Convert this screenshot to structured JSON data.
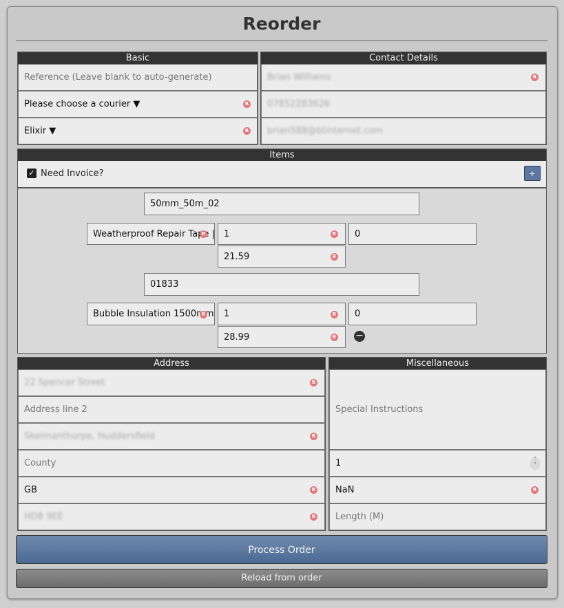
{
  "title": "Reorder",
  "basic": {
    "header": "Basic",
    "reference_placeholder": "Reference (Leave blank to auto-generate)",
    "courier": "Please choose a courier ▼",
    "brand": "Elixir ▼"
  },
  "contact": {
    "header": "Contact Details",
    "name": "Brian Williams",
    "phone": "07852283626",
    "email": "brian588@btinternet.com"
  },
  "items": {
    "header": "Items",
    "invoice_label": "Need Invoice?",
    "invoice_checked": true,
    "add_label": "+",
    "list": [
      {
        "sku": "50mm_50m_02",
        "name": "Weatherproof Repair Tape | ",
        "qty": "1",
        "extra": "0",
        "price": "21.59"
      },
      {
        "sku": "01833",
        "name": "Bubble Insulation 1500mm / ",
        "qty": "1",
        "extra": "0",
        "price": "28.99"
      }
    ],
    "remove_label": "−"
  },
  "address": {
    "header": "Address",
    "line1": "22 Spencer Street",
    "line2_placeholder": "Address line 2",
    "town": "Skelmanthorpe, Huddersfield",
    "county_placeholder": "County",
    "country": "GB",
    "postcode": "HD8 9EE"
  },
  "misc": {
    "header": "Miscellaneous",
    "instructions_placeholder": "Special Instructions",
    "quantity": "1",
    "nan_value": "NaN",
    "length_placeholder": "Length (M)"
  },
  "actions": {
    "process": "Process Order",
    "reload": "Reload from order"
  },
  "required_marker": "R",
  "colors": {
    "header_bg": "#333333",
    "process_button": "#5b7aa2",
    "required_badge": "#e07a7a"
  }
}
